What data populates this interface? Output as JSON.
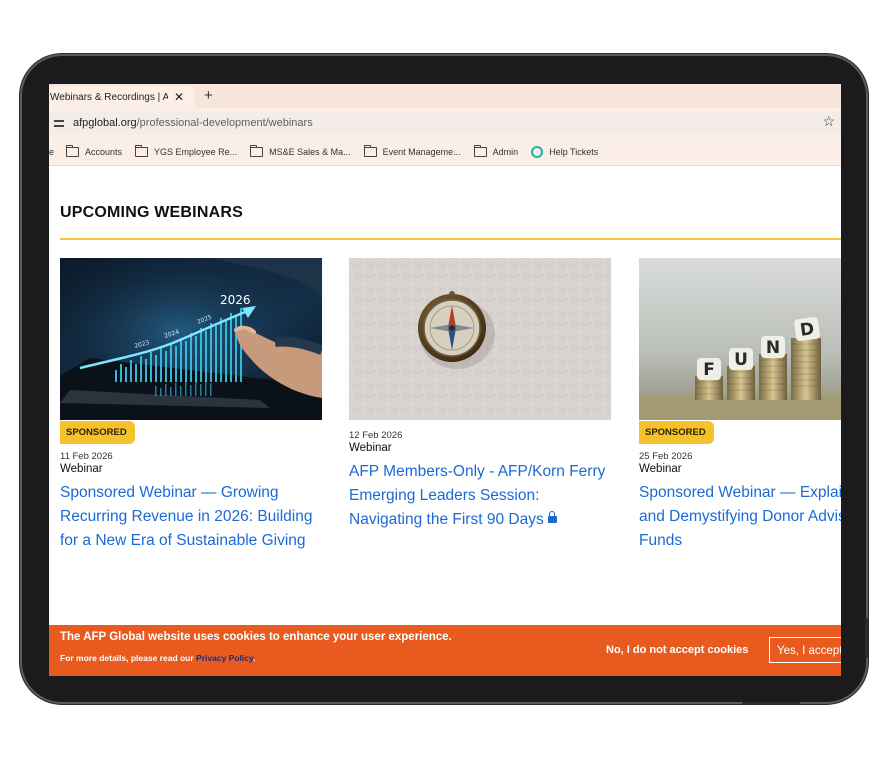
{
  "browser": {
    "tab_title": "Webinars & Recordings | Asso",
    "tab_close": "✕",
    "new_tab": "+",
    "url_host": "afpglobal.org",
    "url_path": "/professional-development/webinars",
    "bookmarks": [
      {
        "label": "e",
        "icon": "none"
      },
      {
        "label": "Accounts",
        "icon": "folder-icon"
      },
      {
        "label": "YGS Employee Re...",
        "icon": "folder-icon"
      },
      {
        "label": "MS&E Sales & Ma...",
        "icon": "folder-icon"
      },
      {
        "label": "Event Manageme...",
        "icon": "folder-icon"
      },
      {
        "label": "Admin",
        "icon": "folder-icon"
      },
      {
        "label": "Help Tickets",
        "icon": "help-icon"
      }
    ]
  },
  "section": {
    "title": "UPCOMING WEBINARS",
    "accent": "#f4c23c"
  },
  "cards": [
    {
      "badge": "SPONSORED",
      "date": "11 Feb 2026",
      "type": "Webinar",
      "title": "Sponsored Webinar — Growing Recurring Revenue in 2026: Building for a New Era of Sustainable Giving",
      "image_text": "2026",
      "image_years": [
        "2023",
        "2024",
        "2025"
      ]
    },
    {
      "badge": "",
      "date": "12 Feb 2026",
      "type": "Webinar",
      "title": "AFP Members-Only - AFP/Korn Ferry Emerging Leaders Session: Navigating the First 90 Days",
      "locked": true
    },
    {
      "badge": "SPONSORED",
      "date": "25 Feb 2026",
      "type": "Webinar",
      "title": "Sponsored Webinar — Explaining and Demystifying Donor Advised Funds",
      "image_letters": [
        "F",
        "U",
        "N",
        "D"
      ]
    }
  ],
  "cookie": {
    "message": "The AFP Global website uses cookies to enhance your user experience.",
    "details_prefix": "For more details, please read our ",
    "policy_link": "Privacy Policy",
    "details_suffix": ".",
    "decline": "No, I do not accept cookies",
    "accept": "Yes, I accept cookies",
    "color": "#e85a1e"
  },
  "colors": {
    "link": "#1a6ad6",
    "badge": "#f5c12d"
  }
}
